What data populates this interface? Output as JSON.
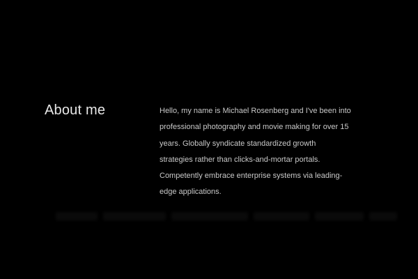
{
  "about": {
    "heading": "About me",
    "lines": [
      "Hello, my name is Michael Rosenberg and I've been into",
      "professional photography and movie making for over 15",
      "years. Globally syndicate standardized growth",
      "strategies rather than clicks-and-mortar portals.",
      "Competently embrace enterprise systems via leading-",
      "edge applications."
    ]
  },
  "colors": {
    "background": "#000000",
    "heading": "#e8e8e8",
    "body_text": "#c9c9c9"
  }
}
